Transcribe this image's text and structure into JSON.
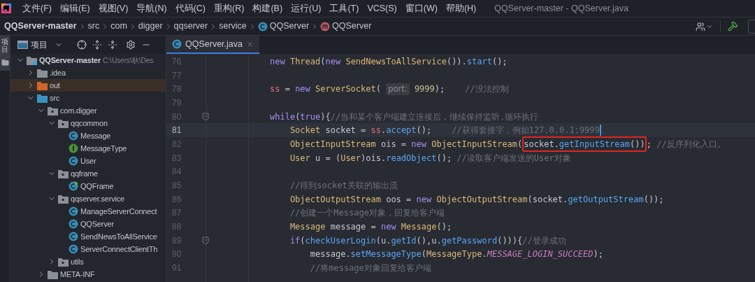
{
  "menu": [
    "文件(F)",
    "编辑(E)",
    "视图(V)",
    "导航(N)",
    "代码(C)",
    "重构(R)",
    "构建(B)",
    "运行(U)",
    "工具(T)",
    "VCS(S)",
    "窗口(W)",
    "帮助(H)"
  ],
  "window": {
    "title": "QQServer-master - QQServer.java"
  },
  "breadcrumbs": [
    {
      "label": "QQServer-master",
      "kind": "project"
    },
    {
      "label": "src",
      "kind": "plain"
    },
    {
      "label": "com",
      "kind": "plain"
    },
    {
      "label": "digger",
      "kind": "plain"
    },
    {
      "label": "qqserver",
      "kind": "plain"
    },
    {
      "label": "service",
      "kind": "plain"
    },
    {
      "label": "QQServer",
      "kind": "class"
    },
    {
      "label": "QQServer",
      "kind": "method"
    }
  ],
  "side_stripe": {
    "label": "项目"
  },
  "project_panel": {
    "title": "项目",
    "tree": [
      {
        "name": "QQServer-master",
        "path": "C:\\Users\\耿\\Des",
        "kind": "module",
        "expanded": true,
        "children": [
          {
            "name": ".idea",
            "kind": "folder",
            "expanded": false
          },
          {
            "name": "out",
            "kind": "excluded",
            "expanded": false
          },
          {
            "name": "src",
            "kind": "source",
            "expanded": true,
            "children": [
              {
                "name": "com.digger",
                "kind": "package",
                "expanded": true,
                "children": [
                  {
                    "name": "qqcommon",
                    "kind": "package",
                    "expanded": true,
                    "children": [
                      {
                        "name": "Message",
                        "kind": "class"
                      },
                      {
                        "name": "MessageType",
                        "kind": "interface"
                      },
                      {
                        "name": "User",
                        "kind": "class"
                      }
                    ]
                  },
                  {
                    "name": "qqframe",
                    "kind": "package",
                    "expanded": true,
                    "children": [
                      {
                        "name": "QQFrame",
                        "kind": "main"
                      }
                    ]
                  },
                  {
                    "name": "qqserver.service",
                    "kind": "package",
                    "expanded": true,
                    "children": [
                      {
                        "name": "ManageServerConnect",
                        "kind": "class"
                      },
                      {
                        "name": "QQServer",
                        "kind": "class"
                      },
                      {
                        "name": "SendNewsToAllService",
                        "kind": "class"
                      },
                      {
                        "name": "ServerConnectClientTh",
                        "kind": "class"
                      }
                    ]
                  },
                  {
                    "name": "utils",
                    "kind": "package",
                    "expanded": false
                  }
                ]
              },
              {
                "name": "META-INF",
                "kind": "folder",
                "expanded": false
              }
            ]
          }
        ]
      }
    ]
  },
  "tabs": [
    {
      "label": "QQServer.java",
      "selected": true
    }
  ],
  "code": [
    {
      "number": "76",
      "current": false,
      "fold": false,
      "tokens": [
        {
          "text": "new ",
          "kind": "kw"
        },
        {
          "text": "Thread",
          "kind": "type"
        },
        {
          "text": "(",
          "kind": "plain"
        },
        {
          "text": "new ",
          "kind": "kw"
        },
        {
          "text": "SendNewsToAllService",
          "kind": "type"
        },
        {
          "text": "()).",
          "kind": "plain"
        },
        {
          "text": "start",
          "kind": "method"
        },
        {
          "text": "();",
          "kind": "plain"
        }
      ]
    },
    {
      "number": "77",
      "current": false,
      "fold": false
    },
    {
      "number": "78",
      "current": false,
      "fold": false,
      "tokens": [
        {
          "text": "ss",
          "kind": "field"
        },
        {
          "text": " = ",
          "kind": "plain"
        },
        {
          "text": "new ",
          "kind": "kw"
        },
        {
          "text": "ServerSocket",
          "kind": "type"
        },
        {
          "text": "( ",
          "kind": "plain"
        },
        {
          "text": "port:",
          "kind": "hint"
        },
        {
          "text": " 9999",
          "kind": "number"
        },
        {
          "text": ");    ",
          "kind": "plain"
        },
        {
          "text": "//没法控制",
          "kind": "comment"
        }
      ]
    },
    {
      "number": "79",
      "current": false,
      "fold": false
    },
    {
      "number": "80",
      "current": false,
      "fold": true,
      "tokens": [
        {
          "text": "while",
          "kind": "kw"
        },
        {
          "text": "(",
          "kind": "plain"
        },
        {
          "text": "true",
          "kind": "kw"
        },
        {
          "text": "){",
          "kind": "plain"
        },
        {
          "text": "//当和某个客户端建立连接后，继续保持监听.循环执行",
          "kind": "comment"
        }
      ]
    },
    {
      "number": "81",
      "current": true,
      "fold": false,
      "tokens": [
        {
          "text": "    Socket ",
          "kind": "type"
        },
        {
          "text": "socket = ",
          "kind": "plain"
        },
        {
          "text": "ss",
          "kind": "field"
        },
        {
          "text": ".",
          "kind": "plain"
        },
        {
          "text": "accept",
          "kind": "method"
        },
        {
          "text": "();    ",
          "kind": "plain"
        },
        {
          "text": "//获得套接字，例如127.0.0.1:9999",
          "kind": "comment"
        }
      ]
    },
    {
      "number": "82",
      "current": false,
      "fold": false,
      "tokens": [
        {
          "text": "    ObjectInputStream ",
          "kind": "type"
        },
        {
          "text": "ois = ",
          "kind": "plain"
        },
        {
          "text": "new ",
          "kind": "kw"
        },
        {
          "text": "ObjectInputStream",
          "kind": "type"
        },
        {
          "text": "(",
          "kind": "plain"
        },
        {
          "kind": "boxed",
          "tokens": [
            {
              "text": "socket.",
              "kind": "plain"
            },
            {
              "text": "getInputStream",
              "kind": "method"
            },
            {
              "text": "())",
              "kind": "plain"
            }
          ]
        },
        {
          "text": "; ",
          "kind": "plain"
        },
        {
          "text": "//反序列化入口。",
          "kind": "comment"
        }
      ]
    },
    {
      "number": "83",
      "current": false,
      "fold": false,
      "tokens": [
        {
          "text": "    User ",
          "kind": "type"
        },
        {
          "text": "u = (",
          "kind": "plain"
        },
        {
          "text": "User",
          "kind": "type"
        },
        {
          "text": ")ois.",
          "kind": "plain"
        },
        {
          "text": "readObject",
          "kind": "method"
        },
        {
          "text": "(); ",
          "kind": "plain"
        },
        {
          "text": "//读取客户端发送的User对象",
          "kind": "comment"
        }
      ]
    },
    {
      "number": "84",
      "current": false,
      "fold": false
    },
    {
      "number": "85",
      "current": false,
      "fold": false,
      "tokens": [
        {
          "text": "    //得到socket关联的输出流",
          "kind": "comment"
        }
      ]
    },
    {
      "number": "86",
      "current": false,
      "fold": false,
      "tokens": [
        {
          "text": "    ObjectOutputStream ",
          "kind": "type"
        },
        {
          "text": "oos = ",
          "kind": "plain"
        },
        {
          "text": "new ",
          "kind": "kw"
        },
        {
          "text": "ObjectOutputStream",
          "kind": "type"
        },
        {
          "text": "(socket.",
          "kind": "plain"
        },
        {
          "text": "getOutputStream",
          "kind": "method"
        },
        {
          "text": "());",
          "kind": "plain"
        }
      ]
    },
    {
      "number": "87",
      "current": false,
      "fold": false,
      "tokens": [
        {
          "text": "    //创建一个Message对象，回复给客户端",
          "kind": "comment"
        }
      ]
    },
    {
      "number": "88",
      "current": false,
      "fold": false,
      "tokens": [
        {
          "text": "    Message ",
          "kind": "type"
        },
        {
          "text": "message = ",
          "kind": "plain"
        },
        {
          "text": "new ",
          "kind": "kw"
        },
        {
          "text": "Message",
          "kind": "type"
        },
        {
          "text": "();",
          "kind": "plain"
        }
      ]
    },
    {
      "number": "89",
      "current": false,
      "fold": true,
      "tokens": [
        {
          "text": "    if",
          "kind": "kw"
        },
        {
          "text": "(",
          "kind": "plain"
        },
        {
          "text": "checkUserLogin",
          "kind": "method"
        },
        {
          "text": "(u.",
          "kind": "plain"
        },
        {
          "text": "getId",
          "kind": "method"
        },
        {
          "text": "(),u.",
          "kind": "plain"
        },
        {
          "text": "getPassword",
          "kind": "method"
        },
        {
          "text": "())){",
          "kind": "plain"
        },
        {
          "text": "//登录成功",
          "kind": "comment"
        }
      ]
    },
    {
      "number": "90",
      "current": false,
      "fold": false,
      "tokens": [
        {
          "text": "        message.",
          "kind": "plain"
        },
        {
          "text": "setMessageType",
          "kind": "method"
        },
        {
          "text": "(",
          "kind": "plain"
        },
        {
          "text": "MessageType",
          "kind": "type"
        },
        {
          "text": ".",
          "kind": "plain"
        },
        {
          "text": "MESSAGE_LOGIN_SUCCEED",
          "kind": "constant"
        },
        {
          "text": ");",
          "kind": "plain"
        }
      ]
    },
    {
      "number": "91",
      "current": false,
      "fold": false,
      "tokens": [
        {
          "text": "        //将message对象回复给客户端",
          "kind": "comment"
        }
      ]
    }
  ]
}
